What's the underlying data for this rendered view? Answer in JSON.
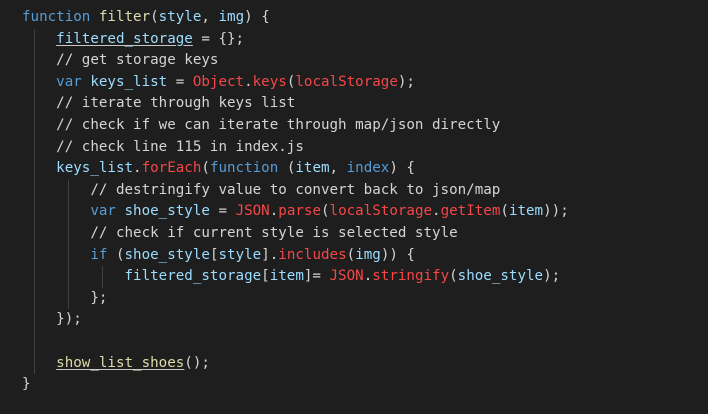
{
  "editor": {
    "lines": [
      {
        "indent": 0,
        "guides": 0,
        "tokens": [
          {
            "t": "function ",
            "c": "kw"
          },
          {
            "t": "filter",
            "c": "fn"
          },
          {
            "t": "(",
            "c": "cm"
          },
          {
            "t": "style",
            "c": "var"
          },
          {
            "t": ", ",
            "c": "cm"
          },
          {
            "t": "img",
            "c": "var"
          },
          {
            "t": ") {",
            "c": "cm"
          }
        ]
      },
      {
        "indent": 1,
        "guides": 1,
        "tokens": [
          {
            "t": "filtered_storage",
            "c": "var un"
          },
          {
            "t": " = {};",
            "c": "cm"
          }
        ]
      },
      {
        "indent": 1,
        "guides": 1,
        "tokens": [
          {
            "t": "// get storage keys",
            "c": "cm"
          }
        ]
      },
      {
        "indent": 1,
        "guides": 1,
        "tokens": [
          {
            "t": "var ",
            "c": "kw"
          },
          {
            "t": "keys_list",
            "c": "var"
          },
          {
            "t": " = ",
            "c": "cm"
          },
          {
            "t": "Object",
            "c": "obj"
          },
          {
            "t": ".",
            "c": "cm"
          },
          {
            "t": "keys",
            "c": "ex"
          },
          {
            "t": "(",
            "c": "cm"
          },
          {
            "t": "localStorage",
            "c": "ex"
          },
          {
            "t": ");",
            "c": "cm"
          }
        ]
      },
      {
        "indent": 1,
        "guides": 1,
        "tokens": [
          {
            "t": "// iterate through keys list",
            "c": "cm"
          }
        ]
      },
      {
        "indent": 1,
        "guides": 1,
        "tokens": [
          {
            "t": "// check if we can iterate through map/json directly",
            "c": "cm"
          }
        ]
      },
      {
        "indent": 1,
        "guides": 1,
        "tokens": [
          {
            "t": "// check line 115 in index.js",
            "c": "cm"
          }
        ]
      },
      {
        "indent": 1,
        "guides": 1,
        "tokens": [
          {
            "t": "keys_list",
            "c": "var"
          },
          {
            "t": ".",
            "c": "cm"
          },
          {
            "t": "forEach",
            "c": "ex"
          },
          {
            "t": "(",
            "c": "cm"
          },
          {
            "t": "function ",
            "c": "kw"
          },
          {
            "t": "(",
            "c": "cm"
          },
          {
            "t": "item",
            "c": "var"
          },
          {
            "t": ", ",
            "c": "cm"
          },
          {
            "t": "index",
            "c": "kw"
          },
          {
            "t": ") {",
            "c": "cm"
          }
        ]
      },
      {
        "indent": 2,
        "guides": 2,
        "tokens": [
          {
            "t": "// destringify value to convert back to json/map",
            "c": "cm"
          }
        ]
      },
      {
        "indent": 2,
        "guides": 2,
        "tokens": [
          {
            "t": "var ",
            "c": "kw"
          },
          {
            "t": "shoe_style",
            "c": "var"
          },
          {
            "t": " = ",
            "c": "cm"
          },
          {
            "t": "JSON",
            "c": "obj"
          },
          {
            "t": ".",
            "c": "cm"
          },
          {
            "t": "parse",
            "c": "ex"
          },
          {
            "t": "(",
            "c": "cm"
          },
          {
            "t": "localStorage",
            "c": "ex"
          },
          {
            "t": ".",
            "c": "cm"
          },
          {
            "t": "getItem",
            "c": "ex"
          },
          {
            "t": "(",
            "c": "cm"
          },
          {
            "t": "item",
            "c": "var"
          },
          {
            "t": "));",
            "c": "cm"
          }
        ]
      },
      {
        "indent": 2,
        "guides": 2,
        "tokens": [
          {
            "t": "// check if current style is selected style",
            "c": "cm"
          }
        ]
      },
      {
        "indent": 2,
        "guides": 2,
        "tokens": [
          {
            "t": "if ",
            "c": "kw"
          },
          {
            "t": "(",
            "c": "cm"
          },
          {
            "t": "shoe_style",
            "c": "var"
          },
          {
            "t": "[",
            "c": "cm"
          },
          {
            "t": "style",
            "c": "var"
          },
          {
            "t": "].",
            "c": "cm"
          },
          {
            "t": "includes",
            "c": "ex"
          },
          {
            "t": "(",
            "c": "cm"
          },
          {
            "t": "img",
            "c": "var"
          },
          {
            "t": ")) {",
            "c": "cm"
          }
        ]
      },
      {
        "indent": 3,
        "guides": 3,
        "tokens": [
          {
            "t": "filtered_storage",
            "c": "var"
          },
          {
            "t": "[",
            "c": "cm"
          },
          {
            "t": "item",
            "c": "var"
          },
          {
            "t": "]= ",
            "c": "cm"
          },
          {
            "t": "JSON",
            "c": "obj"
          },
          {
            "t": ".",
            "c": "cm"
          },
          {
            "t": "stringify",
            "c": "ex"
          },
          {
            "t": "(",
            "c": "cm"
          },
          {
            "t": "shoe_style",
            "c": "var"
          },
          {
            "t": ");",
            "c": "cm"
          }
        ]
      },
      {
        "indent": 2,
        "guides": 2,
        "tokens": [
          {
            "t": "};",
            "c": "cm"
          }
        ]
      },
      {
        "indent": 1,
        "guides": 1,
        "tokens": [
          {
            "t": "});",
            "c": "cm"
          }
        ]
      },
      {
        "indent": 0,
        "guides": 1,
        "tokens": []
      },
      {
        "indent": 1,
        "guides": 1,
        "tokens": [
          {
            "t": "show_list_shoes",
            "c": "fn un"
          },
          {
            "t": "();",
            "c": "cm"
          }
        ]
      },
      {
        "indent": 0,
        "guides": 0,
        "tokens": [
          {
            "t": "}",
            "c": "cm"
          }
        ]
      }
    ]
  },
  "colors": {
    "background": "#1e1e1e",
    "keyword": "#569cd6",
    "function": "#dcdcaa",
    "variable": "#9cdcfe",
    "builtin": "#f44747",
    "text": "#d4d4d4"
  }
}
